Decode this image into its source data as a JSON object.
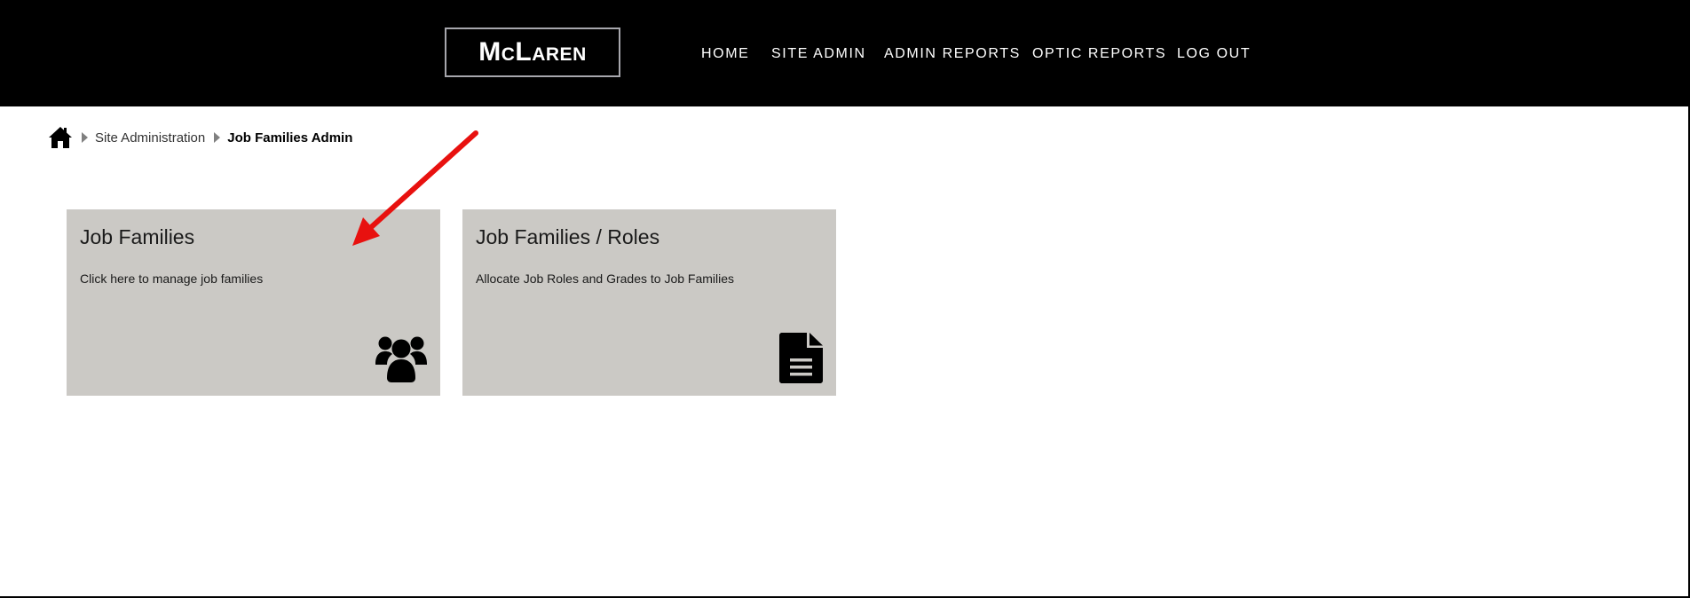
{
  "header": {
    "logo_text": "McLaren",
    "nav": [
      {
        "label": "HOME"
      },
      {
        "label": "SITE ADMIN"
      },
      {
        "label": "ADMIN REPORTS"
      },
      {
        "label": "OPTIC REPORTS"
      },
      {
        "label": "LOG OUT"
      }
    ]
  },
  "breadcrumb": {
    "home_icon": "home-icon",
    "items": [
      {
        "label": "Site Administration"
      },
      {
        "label": "Job Families Admin"
      }
    ]
  },
  "tiles": [
    {
      "title": "Job Families",
      "description": "Click here to manage job families",
      "icon": "users-icon"
    },
    {
      "title": "Job Families / Roles",
      "description": "Allocate Job Roles and Grades to Job Families",
      "icon": "document-icon"
    }
  ],
  "colors": {
    "header_bg": "#000000",
    "tile_bg": "#cbc9c5",
    "annotation_arrow": "#e8110f"
  }
}
